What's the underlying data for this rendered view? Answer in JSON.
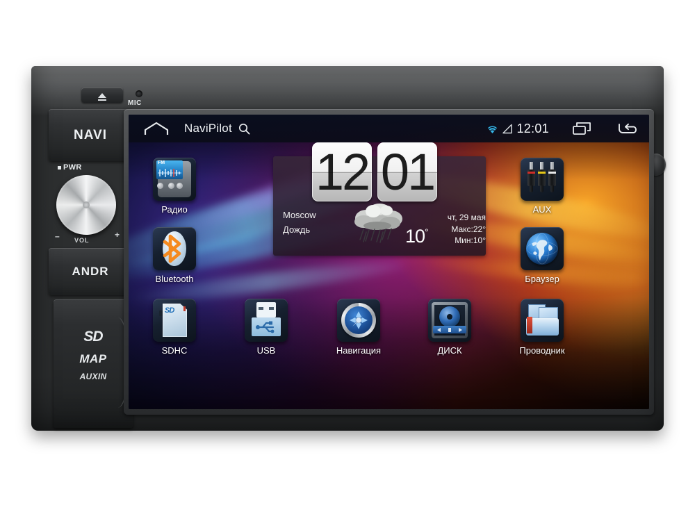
{
  "device": {
    "left_controls": {
      "eject_label": "eject-button",
      "mic_label": "MIC",
      "navi_label": "NAVI",
      "pwr_label": "PWR",
      "vol_label": "VOL",
      "vol_minus": "–",
      "vol_plus": "+",
      "andr_label": "ANDR",
      "slot_sd": "SD",
      "slot_map": "MAP",
      "slot_auxin": "AUXIN"
    }
  },
  "statusbar": {
    "home_icon": "home-icon",
    "title": "NaviPilot",
    "search_icon": "search-icon",
    "wifi_icon": "wifi-icon",
    "signal_icon": "signal-icon",
    "time": "12:01",
    "recents_icon": "recents-icon",
    "back_icon": "back-icon"
  },
  "widget": {
    "hours": "12",
    "minutes": "01",
    "city": "Moscow",
    "condition": "Дождь",
    "weather_icon": "rain-cloud-icon",
    "temperature": "10",
    "degree": "°",
    "date": "чт, 29 мая",
    "max": "Макс:22°",
    "min": "Мин:10°"
  },
  "apps": {
    "radio": {
      "label": "Радио",
      "icon": "radio-icon",
      "fm": "FM"
    },
    "bluetooth": {
      "label": "Bluetooth",
      "icon": "bluetooth-icon"
    },
    "sdhc": {
      "label": "SDHC",
      "icon": "sd-card-icon",
      "card_text": "SD"
    },
    "usb": {
      "label": "USB",
      "icon": "usb-icon"
    },
    "navigation": {
      "label": "Навигация",
      "icon": "compass-icon"
    },
    "disc": {
      "label": "ДИСК",
      "icon": "disc-player-icon"
    },
    "aux": {
      "label": "AUX",
      "icon": "rca-plugs-icon"
    },
    "browser": {
      "label": "Браузер",
      "icon": "globe-icon"
    },
    "explorer": {
      "label": "Проводник",
      "icon": "file-folder-icon"
    }
  },
  "colors": {
    "accent_cyan": "#45c8f0",
    "bluetooth_orange": "#f58a1f",
    "screen_bg_left": "#2a0b36",
    "screen_bg_right": "#4d1410",
    "bezel": "#3a3c3e"
  }
}
